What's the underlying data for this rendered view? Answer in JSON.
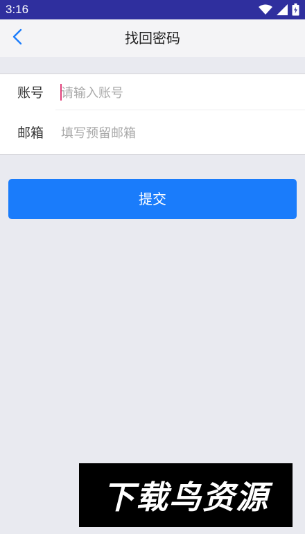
{
  "status_bar": {
    "time": "3:16",
    "icons": [
      "wifi-icon",
      "cell-signal-icon",
      "battery-icon"
    ],
    "background": "#2f2f9e"
  },
  "header": {
    "title": "找回密码",
    "back_icon": "chevron-left-icon",
    "back_icon_color": "#1a7cfb"
  },
  "form": {
    "account": {
      "label": "账号",
      "value": "",
      "placeholder": "请输入账号"
    },
    "email": {
      "label": "邮箱",
      "value": "",
      "placeholder": "填写预留邮箱"
    }
  },
  "submit": {
    "label": "提交",
    "color": "#1a7cfb"
  },
  "watermark": {
    "text": "下载鸟资源"
  }
}
